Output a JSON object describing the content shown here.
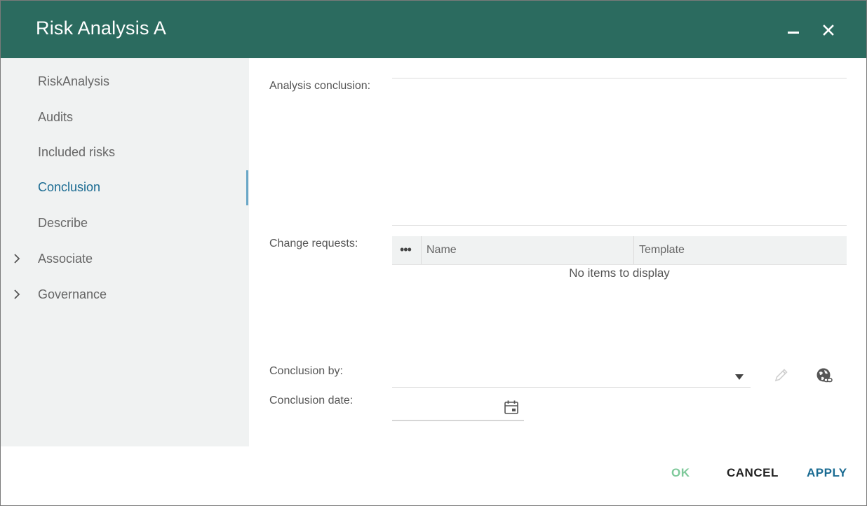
{
  "window": {
    "title": "Risk Analysis A",
    "minimize_icon": "minimize-icon",
    "close_icon": "close-icon"
  },
  "sidebar": {
    "items": [
      {
        "label": "RiskAnalysis",
        "active": false,
        "expandable": false
      },
      {
        "label": "Audits",
        "active": false,
        "expandable": false
      },
      {
        "label": "Included risks",
        "active": false,
        "expandable": false
      },
      {
        "label": "Conclusion",
        "active": true,
        "expandable": false
      },
      {
        "label": "Describe",
        "active": false,
        "expandable": false
      },
      {
        "label": "Associate",
        "active": false,
        "expandable": true
      },
      {
        "label": "Governance",
        "active": false,
        "expandable": true
      }
    ]
  },
  "form": {
    "analysis_conclusion": {
      "label": "Analysis conclusion:",
      "value": ""
    },
    "change_requests": {
      "label": "Change requests:",
      "columns": [
        "Name",
        "Template"
      ],
      "menu_icon": "ellipsis-icon",
      "empty_text": "No items to display",
      "rows": []
    },
    "conclusion_by": {
      "label": "Conclusion by:",
      "value": "",
      "dropdown_icon": "caret-down-icon",
      "edit_icon": "pencil-icon",
      "link_icon": "globe-link-icon"
    },
    "conclusion_date": {
      "label": "Conclusion date:",
      "value": "",
      "calendar_icon": "calendar-icon"
    }
  },
  "footer": {
    "ok": "OK",
    "cancel": "CANCEL",
    "apply": "APPLY"
  },
  "colors": {
    "header": "#2b6b5f",
    "sidebar_bg": "#f0f2f2",
    "active": "#1a6b92",
    "ok_disabled": "#7ec99a"
  }
}
